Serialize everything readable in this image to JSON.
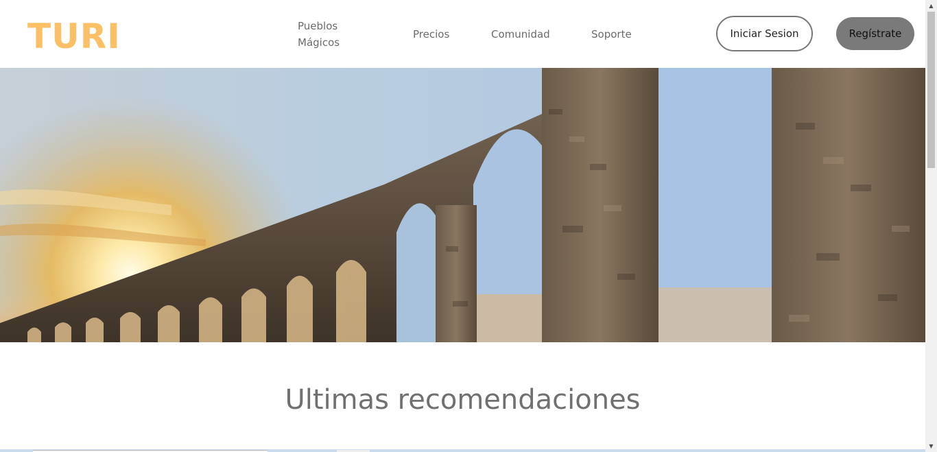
{
  "header": {
    "logo": "TURI",
    "nav": [
      {
        "label": "Pueblos Mágicos"
      },
      {
        "label": "Precios"
      },
      {
        "label": "Comunidad"
      },
      {
        "label": "Soporte"
      }
    ],
    "login_label": "Iniciar Sesion",
    "register_label": "Regístrate"
  },
  "hero": {
    "image_icon": "aqueduct-arches-sunset-photo"
  },
  "section": {
    "title": "Ultimas recomendaciones"
  },
  "scrollbar": {
    "up_icon": "scroll-up-arrow-icon",
    "down_icon": "scroll-down-arrow-icon"
  },
  "colors": {
    "brand": "#fbbf66",
    "nav_text": "#6b6b6b",
    "register_bg": "#7a7a7a",
    "title_text": "#707070"
  }
}
